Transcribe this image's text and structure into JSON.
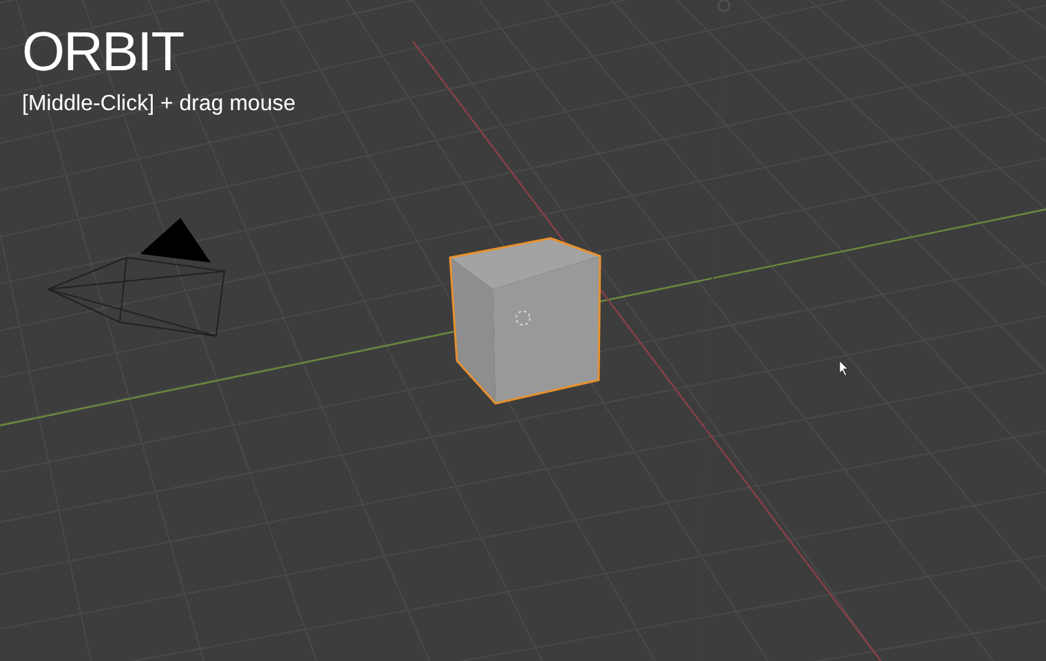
{
  "overlay": {
    "title": "ORBIT",
    "hint": "[Middle-Click] + drag mouse"
  },
  "cube": {
    "selected": true
  }
}
